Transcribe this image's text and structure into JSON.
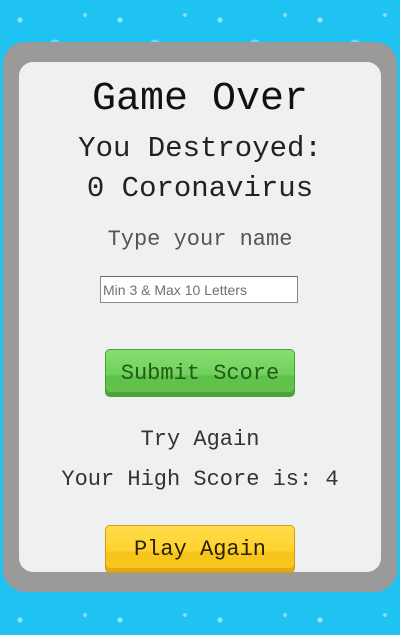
{
  "game_over": {
    "title": "Game Over",
    "destroyed_label": "You Destroyed:",
    "destroyed_count": "0 Coronavirus",
    "name_prompt": "Type your name",
    "name_input": {
      "value": "",
      "placeholder": "Min 3 & Max 10 Letters"
    },
    "submit_label": "Submit Score",
    "try_again_label": "Try Again",
    "high_score_text": "Your High Score is: 4",
    "play_again_label": "Play Again"
  },
  "colors": {
    "background": "#1ec3f2",
    "panel_border": "#9a9a9a",
    "panel_fill": "#eff0f2",
    "submit_button": "#6fd05a",
    "play_button": "#ffd22e"
  }
}
